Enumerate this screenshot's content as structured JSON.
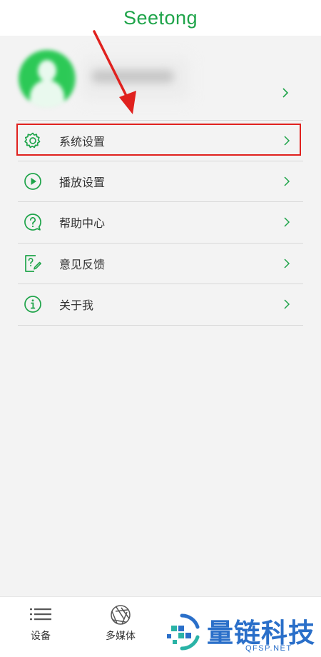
{
  "header": {
    "title": "Seetong"
  },
  "menu": {
    "items": [
      {
        "label": "系统设置",
        "icon": "gear-icon"
      },
      {
        "label": "播放设置",
        "icon": "play-icon"
      },
      {
        "label": "帮助中心",
        "icon": "question-icon"
      },
      {
        "label": "意见反馈",
        "icon": "feedback-icon"
      },
      {
        "label": "关于我",
        "icon": "info-icon"
      }
    ]
  },
  "tabs": [
    {
      "label": "设备",
      "icon": "list-icon"
    },
    {
      "label": "多媒体",
      "icon": "aperture-icon"
    }
  ],
  "watermark": {
    "text": "量链科技",
    "sub": "QFSP.NET"
  },
  "colors": {
    "accent": "#1fa44a",
    "highlight": "#e0211e",
    "watermark": "#2a6fc9"
  }
}
